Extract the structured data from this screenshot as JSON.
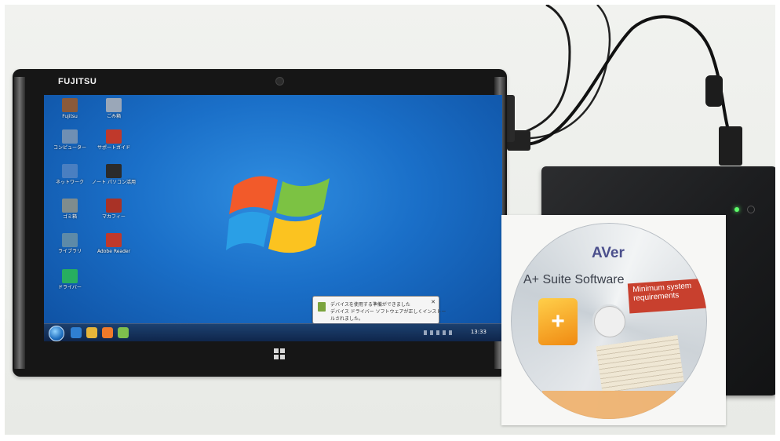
{
  "scene": {
    "tablet_brand": "FUJITSU",
    "cd_brand": "AVer",
    "cd_title": "A+ Suite Software",
    "cd_ribbon": "Minimum system requirements",
    "notification": {
      "line1": "デバイスを使用する準備ができました",
      "line2": "デバイス ドライバー ソフトウェアが正しくインストー",
      "line3": "ルされました。"
    },
    "clock": "13:33",
    "desktop_icons": [
      {
        "label": "Fujitsu",
        "color": "#8a5a3a"
      },
      {
        "label": "ごみ箱",
        "color": "#9aa7b8"
      },
      {
        "label": "コンピューター",
        "color": "#6f8fb3"
      },
      {
        "label": "サポートガイド",
        "color": "#c0392b"
      },
      {
        "label": "ネットワーク",
        "color": "#4a7fc1"
      },
      {
        "label": "ノート パソコン活用",
        "color": "#2b2b2b"
      },
      {
        "label": "ゴミ箱",
        "color": "#7f8c8d"
      },
      {
        "label": "マカフィー",
        "color": "#a93226"
      },
      {
        "label": "ライブラリ",
        "color": "#5d8aa8"
      },
      {
        "label": "Adobe Reader",
        "color": "#c0392b"
      },
      {
        "label": "ドライバー",
        "color": "#27ae60"
      }
    ]
  }
}
